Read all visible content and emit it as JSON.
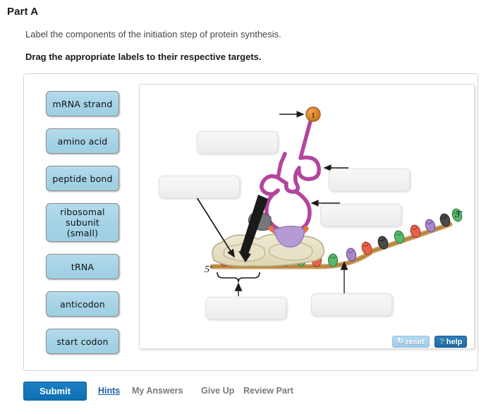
{
  "header": {
    "part_title": "Part A",
    "instruction": "Label the components of the initiation step of protein synthesis.",
    "directive": "Drag the appropriate labels to their respective targets."
  },
  "label_bank": {
    "items": [
      {
        "id": "mrna-strand",
        "label": "mRNA strand"
      },
      {
        "id": "amino-acid",
        "label": "amino acid"
      },
      {
        "id": "peptide-bond",
        "label": "peptide bond"
      },
      {
        "id": "ribosomal-subunit-small",
        "label": "ribosomal subunit (small)"
      },
      {
        "id": "trna",
        "label": "tRNA"
      },
      {
        "id": "anticodon",
        "label": "anticodon"
      },
      {
        "id": "start-codon",
        "label": "start codon"
      }
    ]
  },
  "diagram": {
    "drop_targets": [
      {
        "id": "target-1",
        "value": "",
        "points_to": "amino-acid-sphere"
      },
      {
        "id": "target-2",
        "value": "",
        "points_to": "ribosomal-subunit-small"
      },
      {
        "id": "target-3",
        "value": "",
        "points_to": "trna-cloverleaf"
      },
      {
        "id": "target-4",
        "value": "",
        "points_to": "anticodon-region"
      },
      {
        "id": "target-5",
        "value": "",
        "points_to": "start-codon-bracket"
      },
      {
        "id": "target-6",
        "value": "",
        "points_to": "mrna-strand-tail"
      }
    ],
    "annotations": {
      "five_prime": "5′",
      "three_prime": "3′",
      "amino_acid_number": "1"
    },
    "colors": {
      "trna_body": "#b3459e",
      "amino_acid_sphere": "#d8802a",
      "ribosome_fill": "#e3dec2",
      "mrna_backbone": "#c08a3e",
      "base_red": "#e8614c",
      "base_green": "#55b86a",
      "base_purple": "#a887c9",
      "base_gray": "#4a4a4a",
      "anticodon_lavender": "#b49bd6",
      "anticodon_orange": "#e8733c"
    }
  },
  "tools": {
    "reset_label": "reset",
    "reset_icon": "refresh-icon",
    "help_label": "help",
    "help_icon": "question-mark-icon"
  },
  "footer": {
    "submit_label": "Submit",
    "links": [
      {
        "id": "hints",
        "label": "Hints",
        "active": true
      },
      {
        "id": "my-answers",
        "label": "My Answers",
        "active": false
      },
      {
        "id": "give-up",
        "label": "Give Up",
        "active": false
      },
      {
        "id": "review-part",
        "label": "Review Part",
        "active": false
      }
    ]
  }
}
